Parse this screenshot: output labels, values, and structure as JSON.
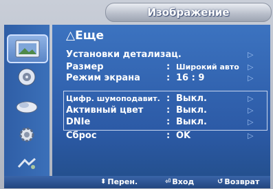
{
  "header": {
    "title": "Изображение"
  },
  "sidebar": {
    "items": [
      {
        "icon": "picture-icon",
        "active": true
      },
      {
        "icon": "sound-icon",
        "active": false
      },
      {
        "icon": "channel-icon",
        "active": false
      },
      {
        "icon": "setup-icon",
        "active": false
      },
      {
        "icon": "input-icon",
        "active": false
      }
    ]
  },
  "panel": {
    "title": "Еще",
    "rows": [
      {
        "label": "Установки детализац.",
        "colon": "",
        "value": ""
      },
      {
        "label": "Размер",
        "colon": ":",
        "value": "Широкий авто"
      },
      {
        "label": "Режим экрана",
        "colon": ":",
        "value": "16 : 9"
      },
      {
        "label": "Цифр. шумоподавит.",
        "colon": ":",
        "value": "Выкл."
      },
      {
        "label": "Активный цвет",
        "colon": ":",
        "value": "Выкл."
      },
      {
        "label": "DNIe",
        "colon": ":",
        "value": "Выкл."
      },
      {
        "label": "Сброс",
        "colon": ":",
        "value": "OK"
      }
    ]
  },
  "footer": {
    "move_label": "Перен.",
    "enter_label": "Вход",
    "return_label": "Возврат"
  }
}
